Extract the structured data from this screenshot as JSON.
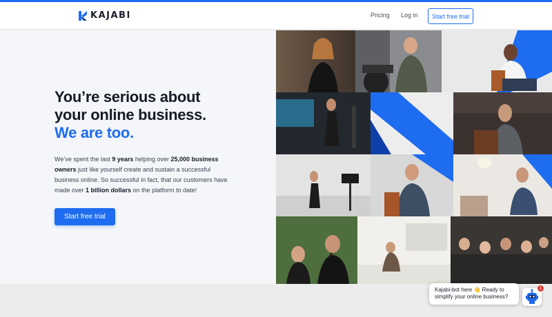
{
  "header": {
    "logo_text": "KAJABI",
    "nav": {
      "pricing_label": "Pricing",
      "login_label": "Log in",
      "cta_label": "Start free trial"
    }
  },
  "hero": {
    "headline_line1": "You’re serious about",
    "headline_line2": "your online business.",
    "headline_accent": "We are too.",
    "lead_part1": "We’ve spent the last ",
    "lead_bold1": "9 years",
    "lead_part2": " helping over ",
    "lead_bold2": "25,000 business owners",
    "lead_part3": " just like yourself create and sustain a successful business online. So successful in fact, that our customers have made over ",
    "lead_bold3": "1 billion dollars",
    "lead_part4": " on the platform to date!",
    "cta_label": "Start free trial"
  },
  "chat": {
    "message": "Kajabi-bot here 👋 Ready to simplify your online business?",
    "unread_count": "1"
  },
  "colors": {
    "brand": "#1e6cf0",
    "badge": "#e53935"
  }
}
